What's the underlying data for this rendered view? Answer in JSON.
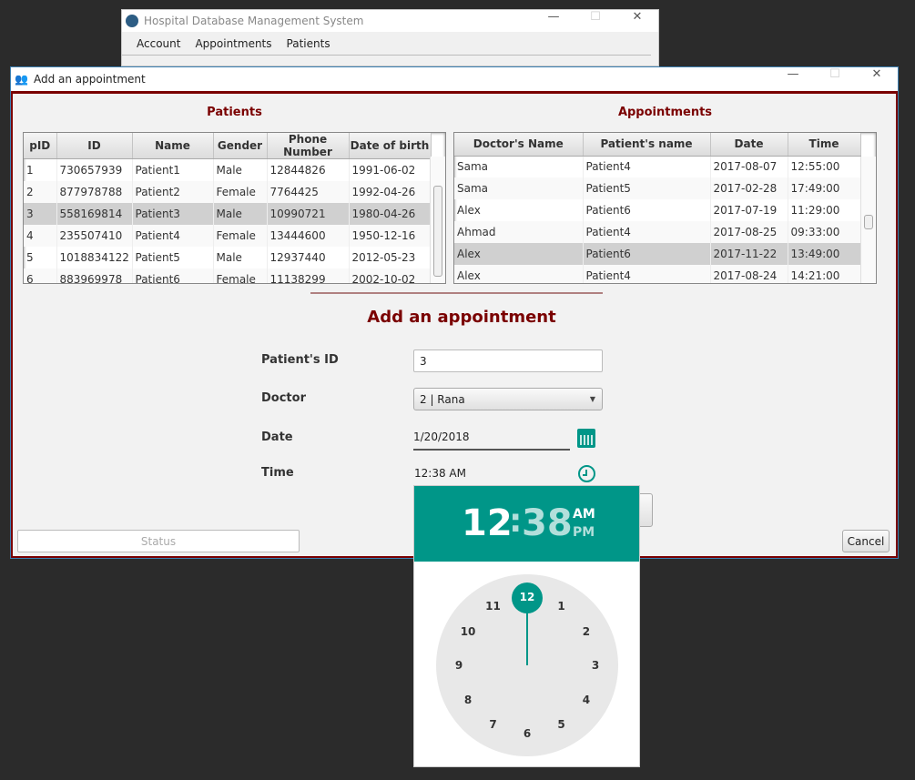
{
  "main_window": {
    "title": "Hospital Database Management System",
    "menu": [
      "Account",
      "Appointments",
      "Patients"
    ]
  },
  "dialog": {
    "title": "Add an appointment"
  },
  "patients": {
    "title": "Patients",
    "columns": [
      "pID",
      "ID",
      "Name",
      "Gender",
      "Phone Number",
      "Date of birth"
    ],
    "rows": [
      [
        "1",
        "730657939",
        "Patient1",
        "Male",
        "12844826",
        "1991-06-02"
      ],
      [
        "2",
        "877978788",
        "Patient2",
        "Female",
        "7764425",
        "1992-04-26"
      ],
      [
        "3",
        "558169814",
        "Patient3",
        "Male",
        "10990721",
        "1980-04-26"
      ],
      [
        "4",
        "235507410",
        "Patient4",
        "Female",
        "13444600",
        "1950-12-16"
      ],
      [
        "5",
        "1018834122",
        "Patient5",
        "Male",
        "12937440",
        "2012-05-23"
      ],
      [
        "6",
        "883969978",
        "Patient6",
        "Female",
        "11138299",
        "2002-10-02"
      ]
    ],
    "selected_row": 2
  },
  "appointments": {
    "title": "Appointments",
    "columns": [
      "Doctor's Name",
      "Patient's name",
      "Date",
      "Time"
    ],
    "rows": [
      [
        "Sama",
        "Patient4",
        "2017-08-07",
        "12:55:00"
      ],
      [
        "Sama",
        "Patient5",
        "2017-02-28",
        "17:49:00"
      ],
      [
        "Alex",
        "Patient6",
        "2017-07-19",
        "11:29:00"
      ],
      [
        "Ahmad",
        "Patient4",
        "2017-08-25",
        "09:33:00"
      ],
      [
        "Alex",
        "Patient6",
        "2017-11-22",
        "13:49:00"
      ],
      [
        "Alex",
        "Patient4",
        "2017-08-24",
        "14:21:00"
      ]
    ],
    "selected_row": 4
  },
  "form": {
    "title": "Add an appointment",
    "patient_id_label": "Patient's ID",
    "patient_id_value": "3",
    "doctor_label": "Doctor",
    "doctor_value": "2 | Rana",
    "date_label": "Date",
    "date_value": "1/20/2018",
    "time_label": "Time",
    "time_value": "12:38 AM"
  },
  "status": "Status",
  "cancel": "Cancel",
  "time_picker": {
    "hour": "12",
    "colon": ":",
    "minute": "38",
    "am": "AM",
    "pm": "PM",
    "selected_period": "AM",
    "dial": [
      "12",
      "1",
      "2",
      "3",
      "4",
      "5",
      "6",
      "7",
      "8",
      "9",
      "10",
      "11"
    ],
    "selected_hour": "12"
  },
  "colors": {
    "accent": "#009688",
    "title": "#7a0000"
  }
}
